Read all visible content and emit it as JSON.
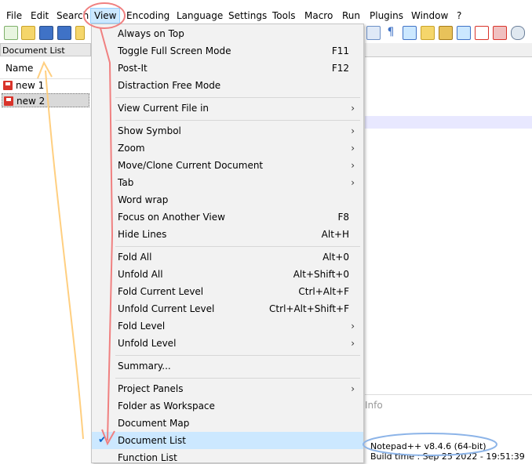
{
  "menubar": {
    "items": [
      "File",
      "Edit",
      "Search",
      "View",
      "Encoding",
      "Language",
      "Settings",
      "Tools",
      "Macro",
      "Run",
      "Plugins",
      "Window",
      "?"
    ]
  },
  "doclist": {
    "title": "Document List",
    "column_header": "Name",
    "files": [
      "new 1",
      "new 2"
    ]
  },
  "dropdown": {
    "items": [
      {
        "label": "Always on Top",
        "shortcut": "",
        "submenu": false
      },
      {
        "label": "Toggle Full Screen Mode",
        "shortcut": "F11",
        "submenu": false
      },
      {
        "label": "Post-It",
        "shortcut": "F12",
        "submenu": false
      },
      {
        "label": "Distraction Free Mode",
        "shortcut": "",
        "submenu": false
      },
      {
        "label": "View Current File in",
        "shortcut": "",
        "submenu": true
      },
      {
        "label": "Show Symbol",
        "shortcut": "",
        "submenu": true
      },
      {
        "label": "Zoom",
        "shortcut": "",
        "submenu": true
      },
      {
        "label": "Move/Clone Current Document",
        "shortcut": "",
        "submenu": true
      },
      {
        "label": "Tab",
        "shortcut": "",
        "submenu": true
      },
      {
        "label": "Word wrap",
        "shortcut": "",
        "submenu": false
      },
      {
        "label": "Focus on Another View",
        "shortcut": "F8",
        "submenu": false
      },
      {
        "label": "Hide Lines",
        "shortcut": "Alt+H",
        "submenu": false
      },
      {
        "label": "Fold All",
        "shortcut": "Alt+0",
        "submenu": false
      },
      {
        "label": "Unfold All",
        "shortcut": "Alt+Shift+0",
        "submenu": false
      },
      {
        "label": "Fold Current Level",
        "shortcut": "Ctrl+Alt+F",
        "submenu": false
      },
      {
        "label": "Unfold Current Level",
        "shortcut": "Ctrl+Alt+Shift+F",
        "submenu": false
      },
      {
        "label": "Fold Level",
        "shortcut": "",
        "submenu": true
      },
      {
        "label": "Unfold Level",
        "shortcut": "",
        "submenu": true
      },
      {
        "label": "Summary...",
        "shortcut": "",
        "submenu": false
      },
      {
        "label": "Project Panels",
        "shortcut": "",
        "submenu": true
      },
      {
        "label": "Folder as Workspace",
        "shortcut": "",
        "submenu": false
      },
      {
        "label": "Document Map",
        "shortcut": "",
        "submenu": false
      },
      {
        "label": "Document List",
        "shortcut": "",
        "submenu": false,
        "checked": true
      },
      {
        "label": "Function List",
        "shortcut": "",
        "submenu": false
      }
    ],
    "submenu_glyph": "›",
    "check_glyph": "✔"
  },
  "infopanel": {
    "heading": "Info",
    "version": "Notepad++ v8.4.6   (64-bit)",
    "build": "Build time : Sep 25 2022 - 19:51:39"
  },
  "colors": {
    "menu_bg": "#f2f2f2",
    "highlight": "#cce8ff",
    "annotation_red": "#f08080",
    "annotation_orange": "#ffcf80",
    "annotation_blue": "#8cb4e8"
  }
}
